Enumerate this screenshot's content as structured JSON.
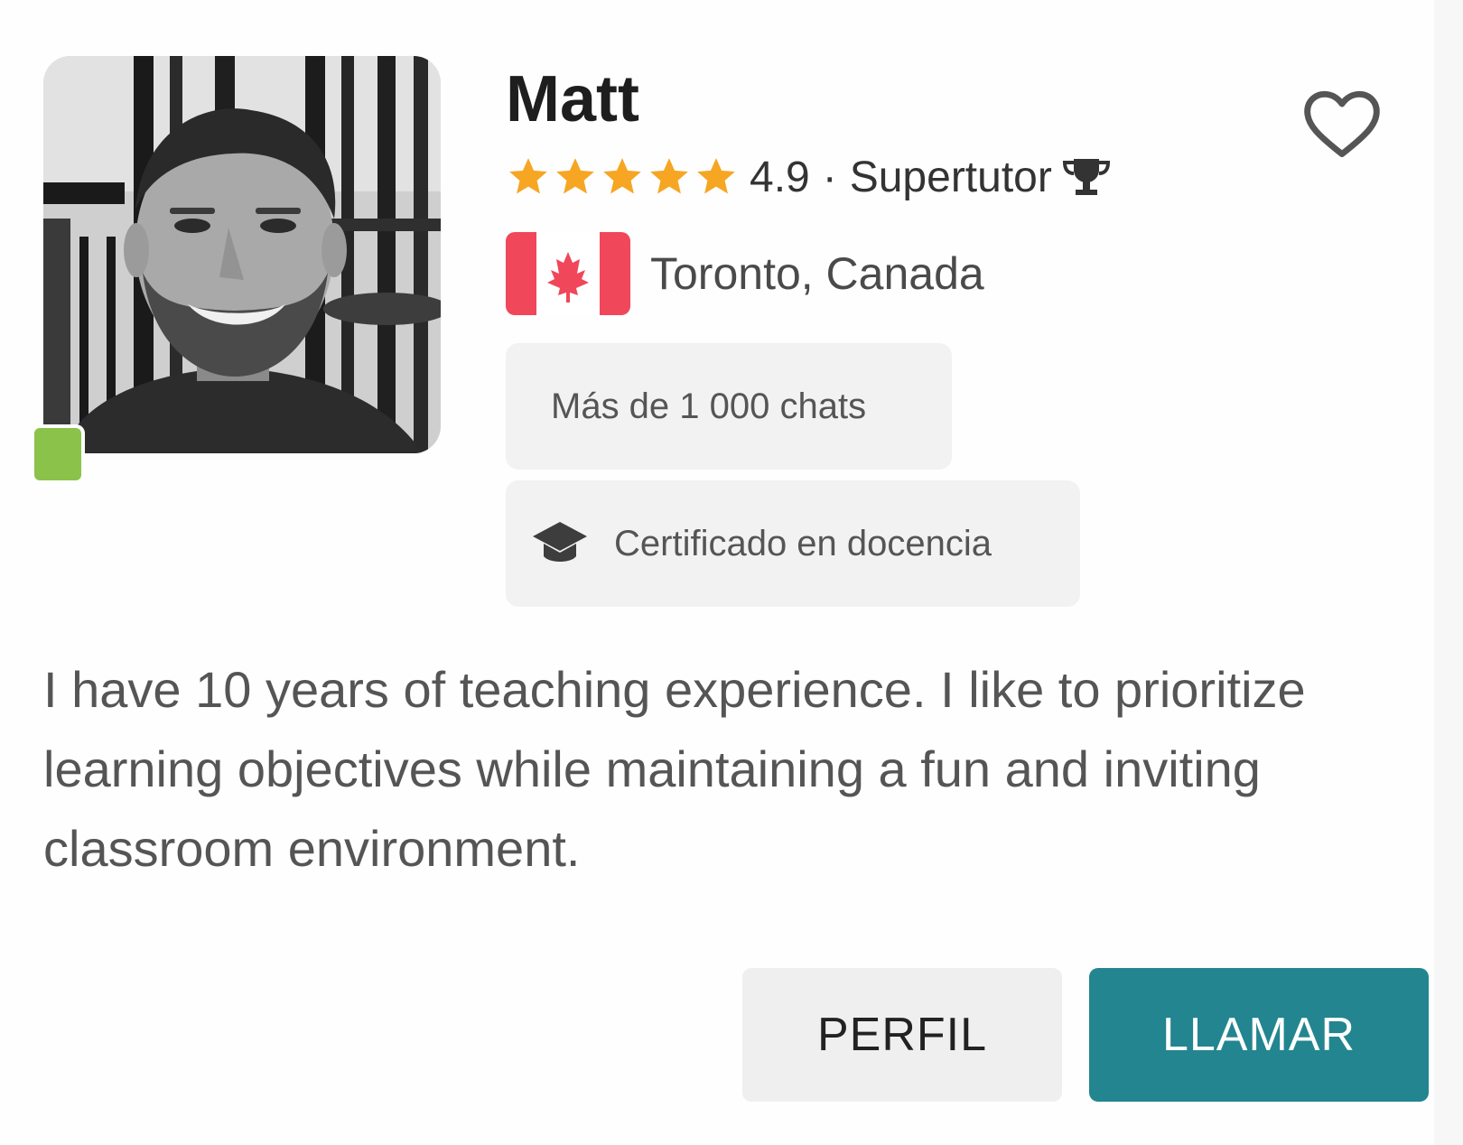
{
  "tutor": {
    "name": "Matt",
    "rating": "4.9",
    "separator": "·",
    "badge": "Supertutor",
    "location": "Toronto, Canada",
    "chats_chip": "Más de 1 000 chats",
    "cert_chip": "Certificado en docencia",
    "bio": "I have 10 years of teaching experience. I like to prioritize learning objectives while maintaining a fun and inviting classroom environment."
  },
  "actions": {
    "profile_label": "PERFIL",
    "call_label": "LLAMAR"
  },
  "icons": {
    "star": "star-icon",
    "trophy": "trophy-icon",
    "flag": "canada-flag-icon",
    "cap": "graduation-cap-icon",
    "heart": "heart-outline-icon"
  },
  "colors": {
    "star": "#f6a623",
    "online": "#8bc34a",
    "call_button": "#22858f",
    "profile_button": "#efefef",
    "flag_red": "#f0475a"
  }
}
